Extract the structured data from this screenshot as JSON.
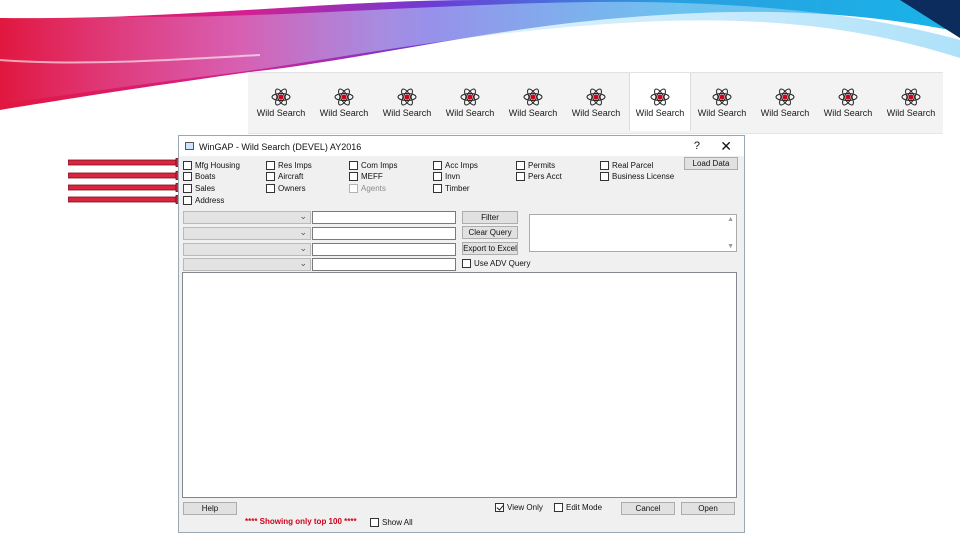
{
  "toolbar": {
    "items": [
      {
        "label": "Wild Search",
        "icon": "atom-icon"
      },
      {
        "label": "Wild Search",
        "icon": "atom-icon"
      },
      {
        "label": "Wild Search",
        "icon": "atom-icon"
      },
      {
        "label": "Wild Search",
        "icon": "atom-icon"
      },
      {
        "label": "Wild Search",
        "icon": "atom-icon"
      },
      {
        "label": "Wild Search",
        "icon": "atom-icon"
      },
      {
        "label": "Wild Search",
        "icon": "atom-icon",
        "selected": true
      },
      {
        "label": "Wild Search",
        "icon": "atom-icon"
      },
      {
        "label": "Wild Search",
        "icon": "atom-icon"
      },
      {
        "label": "Wild Search",
        "icon": "atom-icon"
      },
      {
        "label": "Wild Search",
        "icon": "atom-icon"
      }
    ]
  },
  "window": {
    "title": "WinGAP - Wild Search (DEVEL) AY2016",
    "help": "?",
    "close": "✕"
  },
  "checkboxes": {
    "mfg_housing": {
      "label": "Mfg Housing",
      "checked": false
    },
    "res_imps": {
      "label": "Res Imps",
      "checked": false
    },
    "com_imps": {
      "label": "Com Imps",
      "checked": false
    },
    "acc_imps": {
      "label": "Acc Imps",
      "checked": false
    },
    "permits": {
      "label": "Permits",
      "checked": false
    },
    "real_parcel": {
      "label": "Real Parcel",
      "checked": false
    },
    "boats": {
      "label": "Boats",
      "checked": false
    },
    "aircraft": {
      "label": "Aircraft",
      "checked": false
    },
    "meff": {
      "label": "MEFF",
      "checked": false
    },
    "invn": {
      "label": "Invn",
      "checked": false
    },
    "pers_acct": {
      "label": "Pers Acct",
      "checked": false
    },
    "business_license": {
      "label": "Business License",
      "checked": false
    },
    "sales": {
      "label": "Sales",
      "checked": false
    },
    "owners": {
      "label": "Owners",
      "checked": false
    },
    "agents": {
      "label": "Agents",
      "checked": false,
      "disabled": true
    },
    "timber": {
      "label": "Timber",
      "checked": false
    },
    "address": {
      "label": "Address",
      "checked": false
    },
    "use_adv_query": {
      "label": "Use ADV Query",
      "checked": false
    },
    "view_only": {
      "label": "View Only",
      "checked": true
    },
    "edit_mode": {
      "label": "Edit Mode",
      "checked": false
    },
    "show_all": {
      "label": "Show All",
      "checked": false
    }
  },
  "buttons": {
    "load_data": "Load Data",
    "filter": "Filter",
    "clear_query": "Clear Query",
    "export_to_excel": "Export to Excel",
    "help": "Help",
    "cancel": "Cancel",
    "open": "Open"
  },
  "query_rows": [
    {
      "field": "",
      "value": ""
    },
    {
      "field": "",
      "value": ""
    },
    {
      "field": "",
      "value": ""
    },
    {
      "field": "",
      "value": ""
    }
  ],
  "status": {
    "showing": "**** Showing only top  100 ****"
  },
  "colors": {
    "arrow": "#d7263d",
    "showing_text": "#d0021b"
  }
}
